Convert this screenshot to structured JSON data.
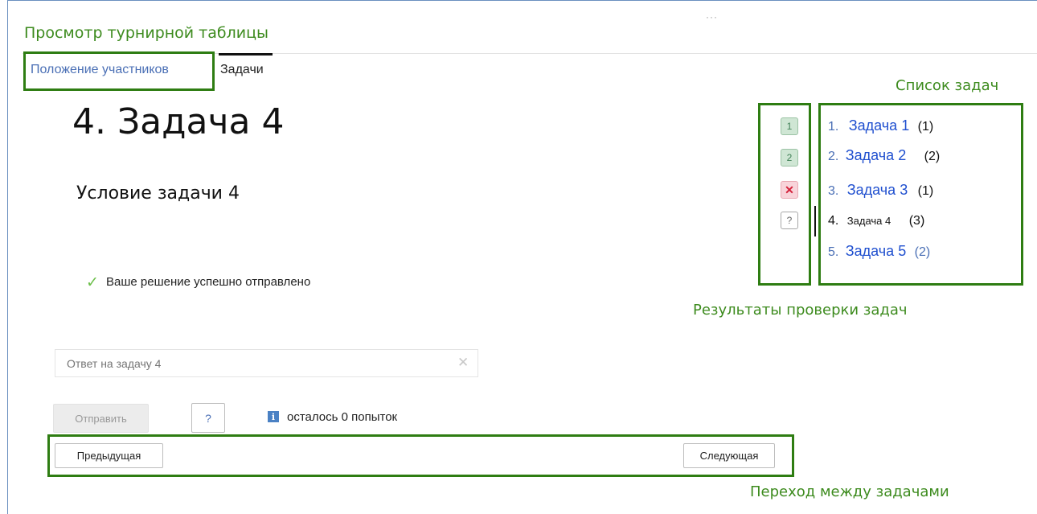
{
  "page": {
    "title": "Просмотр турнирной таблицы",
    "tabs": {
      "standings": "Положение участников",
      "tasks": "Задачи"
    }
  },
  "task": {
    "heading": "4. Задача 4",
    "condition": "Условие задачи 4",
    "success_message": "Ваше решение успешно отправлено",
    "answer_placeholder": "Ответ на задачу 4",
    "answer_value": "",
    "submit_label": "Отправить",
    "help_label": "?",
    "attempts_text": "осталось 0 попыток",
    "info_icon_glyph": "i"
  },
  "navigation": {
    "prev_label": "Предыдущая",
    "next_label": "Следующая"
  },
  "results": [
    {
      "glyph": "1",
      "status": "ok"
    },
    {
      "glyph": "2",
      "status": "ok"
    },
    {
      "glyph": "✕",
      "status": "fail"
    },
    {
      "glyph": "?",
      "status": "unknown"
    }
  ],
  "task_list": [
    {
      "number": "1.",
      "name": "Задача 1",
      "score": "(1)"
    },
    {
      "number": "2.",
      "name": "Задача 2",
      "score": "(2)"
    },
    {
      "number": "3.",
      "name": "Задача 3",
      "score": "(1)"
    },
    {
      "number": "4.",
      "name": "Задача 4",
      "score": "(3)"
    },
    {
      "number": "5.",
      "name": "Задача 5",
      "score": "(2)"
    }
  ],
  "annotations": {
    "task_list": "Список задач",
    "results": "Результаты проверки задач",
    "navigation": "Переход между задачами"
  },
  "colors": {
    "annotation_green": "#2e7d12",
    "link_blue": "#1f4fcf",
    "ok_badge": "#cfe6d4",
    "fail_badge": "#f8d4da"
  },
  "icons": {
    "success": "check-icon",
    "clear": "close-icon",
    "attempts": "info-icon"
  }
}
